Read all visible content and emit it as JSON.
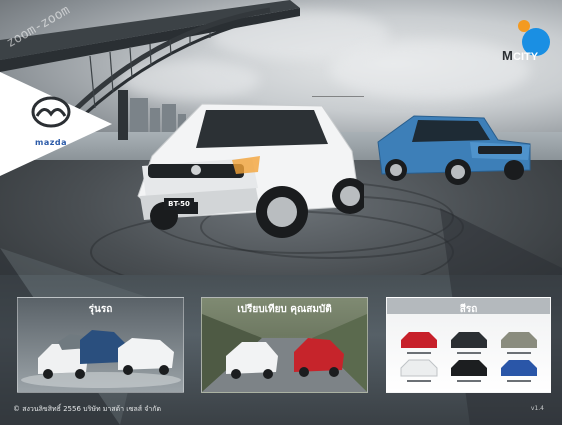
{
  "brand": {
    "name": "mazda",
    "logo": "mazda-logo",
    "badge": "M CITY"
  },
  "sky_text": "zoom-zoom",
  "hero": {
    "model_plate": "BT-50"
  },
  "panels": [
    {
      "title": "รุ่นรถ"
    },
    {
      "title": "เปรียบเทียบ คุณสมบัติ"
    },
    {
      "title": "สีรถ"
    }
  ],
  "footer": {
    "copyright": "© สงวนลิขสิทธิ์ 2556 บริษัท มาสด้า เซลส์ จำกัด",
    "version": "v1.4"
  },
  "colors": {
    "mazda_blue": "#2b5aa8",
    "badge_orange": "#f39a21",
    "badge_blue": "#1a8fe3"
  }
}
